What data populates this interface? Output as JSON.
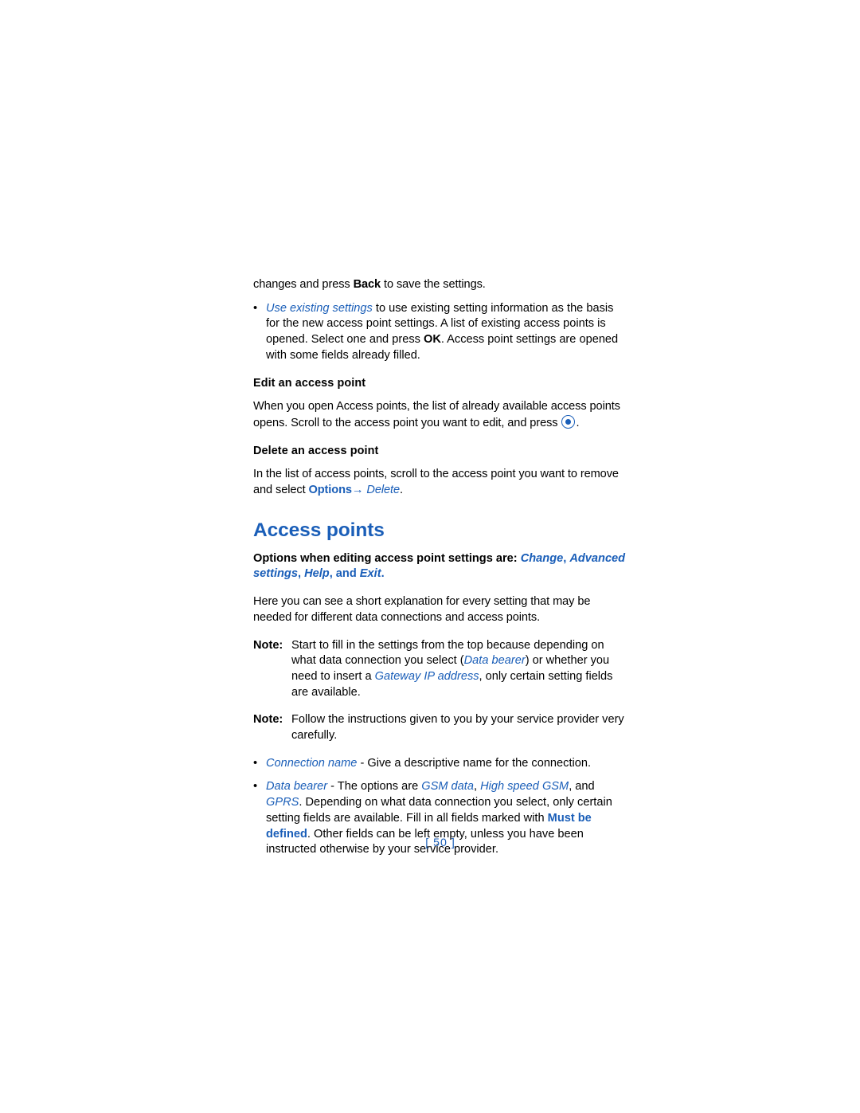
{
  "document": {
    "page_number": "[ 50 ]",
    "blocks": {
      "intro_tail": {
        "pre": "changes and press ",
        "bold_key": "Back",
        "post": " to save the settings."
      },
      "bullet_use_existing": {
        "italic_blue": "Use existing settings",
        "text_1": " to use existing setting information as the basis for the new access point settings. A list of existing access points is opened. Select one and press ",
        "bold_key": "OK",
        "text_2": ". Access point settings are opened with some fields already filled."
      },
      "subhead_edit": "Edit an access point",
      "para_edit": {
        "text_1": "When you open Access points, the list of already available access points opens. Scroll to the access point you want to edit, and press ",
        "icon": "scroll-key-icon",
        "text_2": "."
      },
      "subhead_delete": "Delete an access point",
      "para_delete": {
        "text_1": "In the list of access points, scroll to the access point you want to remove and select ",
        "bold_key": "Options",
        "arrow": "→ ",
        "italic_blue": "Delete",
        "text_2": "."
      },
      "section_title": "Access points",
      "options_line": {
        "prefix": "Options when editing access point settings are: ",
        "opt_1": "Change",
        "sep_1": ", ",
        "opt_2": "Advanced settings",
        "sep_2": ", ",
        "opt_3": "Help",
        "sep_3": ", and ",
        "opt_4": "Exit",
        "suffix": "."
      },
      "para_explanation": "Here you can see a short explanation for every setting that may be needed for different data connections and access points.",
      "note_1": {
        "label": "Note:",
        "text_1": "Start to fill in the settings from the top because depending on what data connection you select (",
        "italic_blue_1": "Data bearer",
        "text_2": ") or whether you need to insert a ",
        "italic_blue_2": "Gateway IP address",
        "text_3": ", only certain setting fields are available."
      },
      "note_2": {
        "label": "Note:",
        "text": "Follow the instructions given to you by your service provider very carefully."
      },
      "bullet_connection_name": {
        "italic_blue": "Connection name",
        "text": " - Give a descriptive name for the connection."
      },
      "bullet_data_bearer": {
        "italic_blue": "Data bearer",
        "text_1": " - The options are ",
        "opt_1": "GSM data",
        "sep_1": ", ",
        "opt_2": "High speed GSM",
        "sep_2": ", and ",
        "opt_3": "GPRS",
        "text_2": ". Depending on what data connection you select, only certain setting fields are available. Fill in all fields marked with ",
        "bold_blue": "Must be defined",
        "text_3": ". Other fields can be left empty, unless you have been instructed otherwise by your service provider."
      }
    },
    "colors": {
      "accent": "#1a5eb8",
      "body_text": "#000000",
      "background": "#ffffff"
    }
  }
}
